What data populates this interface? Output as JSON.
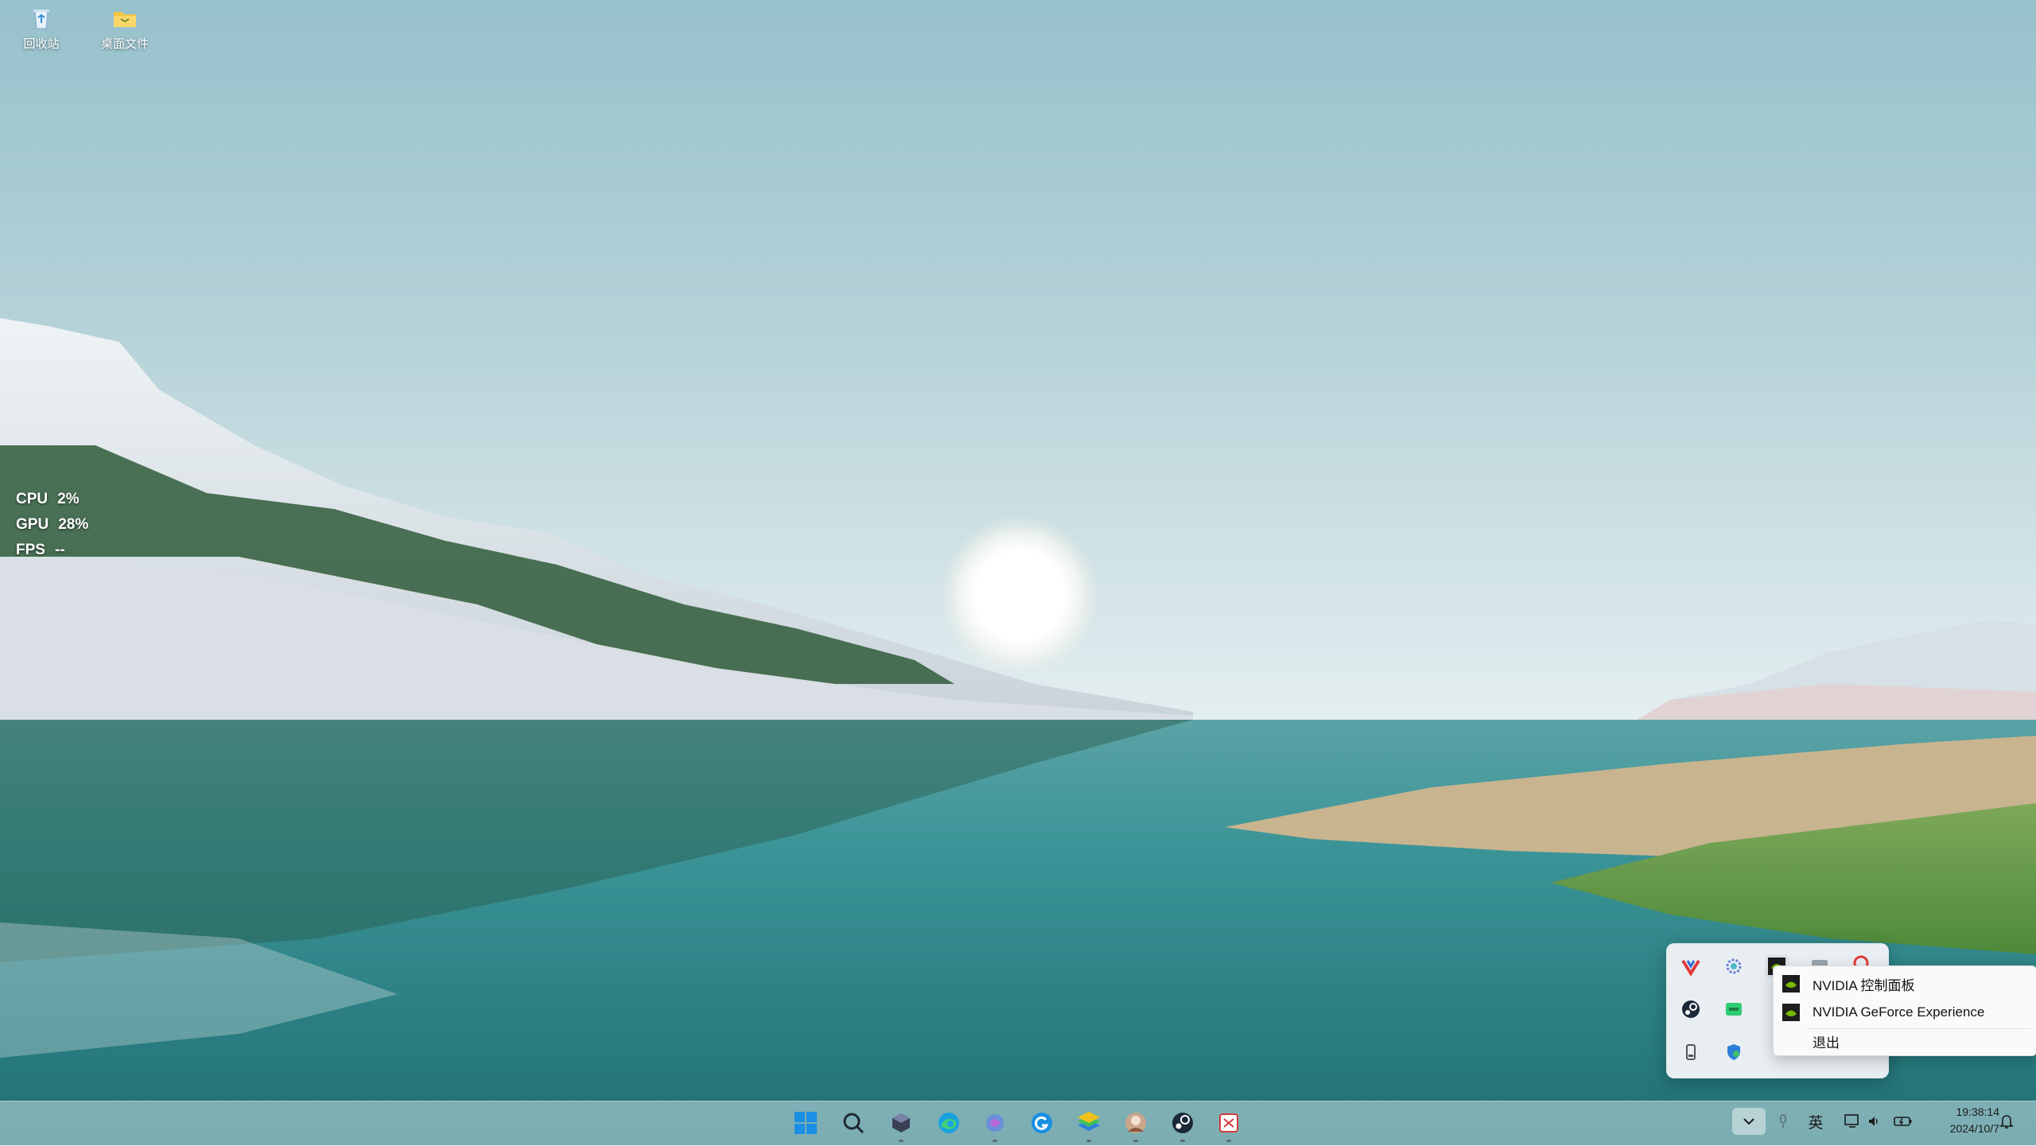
{
  "desktop": {
    "icons": [
      {
        "label": "回收站",
        "icon": "recycle-bin-icon"
      },
      {
        "label": "桌面文件",
        "icon": "folder-icon"
      }
    ]
  },
  "performance_overlay": {
    "cpu_label": "CPU",
    "cpu_value": "2%",
    "gpu_label": "GPU",
    "gpu_value": "28%",
    "fps_label": "FPS",
    "fps_value": "--"
  },
  "tray_overflow": {
    "icons": [
      "vivaldi-icon",
      "gear-badge-icon",
      "nvidia-icon",
      "app-icon",
      "red-circle-icon",
      "steam-icon",
      "green-app-icon",
      "usb-drive-icon",
      "shield-icon"
    ]
  },
  "context_menu": {
    "items": [
      {
        "label": "NVIDIA 控制面板",
        "icon": "nvidia-icon"
      },
      {
        "label": "NVIDIA GeForce Experience",
        "icon": "nvidia-icon"
      },
      {
        "label": "退出",
        "icon": ""
      }
    ]
  },
  "taskbar": {
    "apps": [
      {
        "name": "start",
        "icon": "windows-start-icon"
      },
      {
        "name": "search",
        "icon": "search-icon"
      },
      {
        "name": "app",
        "icon": "cube-app-icon"
      },
      {
        "name": "edge",
        "icon": "edge-icon"
      },
      {
        "name": "app",
        "icon": "swirl-app-icon"
      },
      {
        "name": "google",
        "icon": "google-icon"
      },
      {
        "name": "app",
        "icon": "layers-app-icon"
      },
      {
        "name": "app",
        "icon": "avatar-app-icon"
      },
      {
        "name": "steam",
        "icon": "steam-icon"
      },
      {
        "name": "app",
        "icon": "snip-app-icon"
      }
    ],
    "input_method": "英",
    "clock_time": "19:38:14",
    "clock_date": "2024/10/7"
  },
  "colors": {
    "sky_top": "#97c1cc",
    "sky_horizon": "#e4eef0",
    "lake": "#2f8487",
    "nvidia_green": "#76b900",
    "start_blue": "#1a8fe3"
  }
}
